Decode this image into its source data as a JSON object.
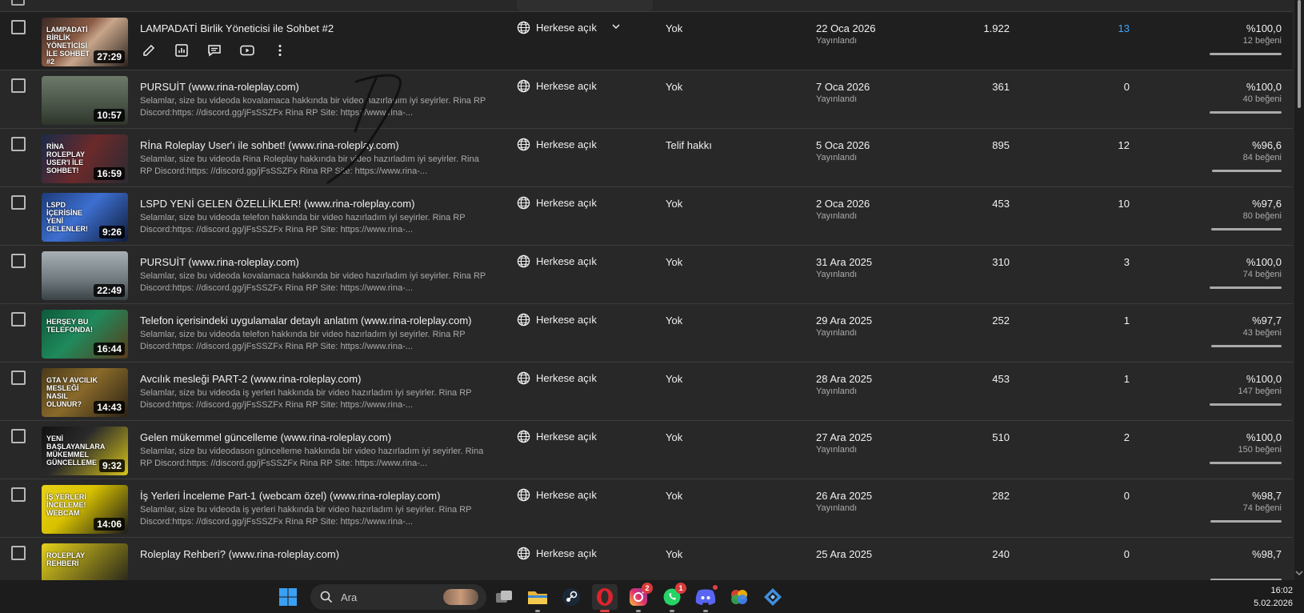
{
  "columns": {
    "visibility_chevron": "chevron-down-icon",
    "date_status": "Yayınlandı",
    "likes_suffix": "beğeni"
  },
  "rows": [
    {
      "title": "LAMPADATİ Birlik Yöneticisi ile Sohbet #2",
      "description": "",
      "duration": "27:29",
      "thumb_caption": "LAMPADATİ BİRLİK YÖNETİCİSİ İLE SOHBET #2",
      "visibility": "Herkese açık",
      "restrictions": "Yok",
      "date": "22 Oca 2026",
      "date_status": "Yayınlandı",
      "views": "1.922",
      "comments": "13",
      "likes_pct": "%100,0",
      "likes_count": "12 beğeni",
      "like_fraction": 1.0,
      "hovered": true
    },
    {
      "title": "PURSUİT (www.rina-roleplay.com)",
      "description": "Selamlar, size bu videoda kovalamaca hakkında bir video hazırladım iyi seyirler. Rina RP Discord:https: //discord.gg/jFsSSZFx Rina RP Site: https://www.rina-...",
      "duration": "10:57",
      "thumb_caption": "",
      "visibility": "Herkese açık",
      "restrictions": "Yok",
      "date": "7 Oca 2026",
      "date_status": "Yayınlandı",
      "views": "361",
      "comments": "0",
      "likes_pct": "%100,0",
      "likes_count": "40 beğeni",
      "like_fraction": 1.0
    },
    {
      "title": "Rİna Roleplay User'ı ile sohbet! (www.rina-roleplay.com)",
      "description": "Selamlar, size bu videoda Rina Roleplay hakkında bir video hazırladım iyi seyirler. Rina RP Discord:https: //discord.gg/jFsSSZFx Rina RP Site: https://www.rina-...",
      "duration": "16:59",
      "thumb_caption": "RİNA ROLEPLAY USER'I İLE SOHBET!",
      "visibility": "Herkese açık",
      "restrictions": "Telif hakkı",
      "date": "5 Oca 2026",
      "date_status": "Yayınlandı",
      "views": "895",
      "comments": "12",
      "likes_pct": "%96,6",
      "likes_count": "84 beğeni",
      "like_fraction": 0.966
    },
    {
      "title": "LSPD YENİ GELEN ÖZELLİKLER! (www.rina-roleplay.com)",
      "description": "Selamlar, size bu videoda telefon hakkında bir video hazırladım iyi seyirler. Rina RP Discord:https: //discord.gg/jFsSSZFx Rina RP Site: https://www.rina-...",
      "duration": "9:26",
      "thumb_caption": "LSPD İÇERİSİNE YENİ GELENLER!",
      "visibility": "Herkese açık",
      "restrictions": "Yok",
      "date": "2 Oca 2026",
      "date_status": "Yayınlandı",
      "views": "453",
      "comments": "10",
      "likes_pct": "%97,6",
      "likes_count": "80 beğeni",
      "like_fraction": 0.976
    },
    {
      "title": "PURSUİT (www.rina-roleplay.com)",
      "description": "Selamlar, size bu videoda kovalamaca hakkında bir video hazırladım iyi seyirler. Rina RP Discord:https: //discord.gg/jFsSSZFx Rina RP Site: https://www.rina-...",
      "duration": "22:49",
      "thumb_caption": "",
      "visibility": "Herkese açık",
      "restrictions": "Yok",
      "date": "31 Ara 2025",
      "date_status": "Yayınlandı",
      "views": "310",
      "comments": "3",
      "likes_pct": "%100,0",
      "likes_count": "74 beğeni",
      "like_fraction": 1.0
    },
    {
      "title": "Telefon içerisindeki uygulamalar detaylı anlatım (www.rina-roleplay.com)",
      "description": "Selamlar, size bu videoda telefon hakkında bir video hazırladım iyi seyirler. Rina RP Discord:https: //discord.gg/jFsSSZFx Rina RP Site: https://www.rina-...",
      "duration": "16:44",
      "thumb_caption": "HERŞEY BU TELEFONDA!",
      "visibility": "Herkese açık",
      "restrictions": "Yok",
      "date": "29 Ara 2025",
      "date_status": "Yayınlandı",
      "views": "252",
      "comments": "1",
      "likes_pct": "%97,7",
      "likes_count": "43 beğeni",
      "like_fraction": 0.977
    },
    {
      "title": "Avcılık mesleği PART-2 (www.rina-roleplay.com)",
      "description": "Selamlar, size bu videoda iş yerleri hakkında bir video hazırladım iyi seyirler. Rina RP Discord:https: //discord.gg/jFsSSZFx Rina RP Site: https://www.rina-...",
      "duration": "14:43",
      "thumb_caption": "GTA V AVCILIK MESLEĞİ NASIL OLUNUR?",
      "visibility": "Herkese açık",
      "restrictions": "Yok",
      "date": "28 Ara 2025",
      "date_status": "Yayınlandı",
      "views": "453",
      "comments": "1",
      "likes_pct": "%100,0",
      "likes_count": "147 beğeni",
      "like_fraction": 1.0
    },
    {
      "title": "Gelen mükemmel güncelleme (www.rina-roleplay.com)",
      "description": "Selamlar, size bu videodason güncelleme hakkında bir video hazırladım iyi seyirler. Rina RP Discord:https: //discord.gg/jFsSSZFx Rina RP Site: https://www.rina-...",
      "duration": "9:32",
      "thumb_caption": "YENİ BAŞLAYANLARA MÜKEMMEL GÜNCELLEME",
      "visibility": "Herkese açık",
      "restrictions": "Yok",
      "date": "27 Ara 2025",
      "date_status": "Yayınlandı",
      "views": "510",
      "comments": "2",
      "likes_pct": "%100,0",
      "likes_count": "150 beğeni",
      "like_fraction": 1.0
    },
    {
      "title": "İş Yerleri İnceleme Part-1 (webcam özel) (www.rina-roleplay.com)",
      "description": "Selamlar, size bu videoda iş yerleri hakkında bir video hazırladım iyi seyirler. Rina RP Discord:https: //discord.gg/jFsSSZFx Rina RP Site: https://www.rina-...",
      "duration": "14:06",
      "thumb_caption": "İŞ YERLERİ İNCELEME! WEBCAM",
      "visibility": "Herkese açık",
      "restrictions": "Yok",
      "date": "26 Ara 2025",
      "date_status": "Yayınlandı",
      "views": "282",
      "comments": "0",
      "likes_pct": "%98,7",
      "likes_count": "74 beğeni",
      "like_fraction": 0.987
    },
    {
      "title": "Roleplay Rehberi? (www.rina-roleplay.com)",
      "description": "",
      "duration": "",
      "thumb_caption": "ROLEPLAY REHBERİ",
      "visibility": "Herkese açık",
      "restrictions": "Yok",
      "date": "25 Ara 2025",
      "date_status": "",
      "views": "240",
      "comments": "0",
      "likes_pct": "%98,7",
      "likes_count": "",
      "like_fraction": 0.987
    }
  ],
  "row_actions": [
    "pencil-icon",
    "analytics-icon",
    "comments-icon",
    "youtube-play-icon",
    "more-vert-icon"
  ],
  "taskbar": {
    "search_placeholder": "Ara",
    "time": "16:02",
    "date": "5.02.2026",
    "apps": [
      "windows-start-icon",
      "search-icon",
      "task-view-icon",
      "file-explorer-icon",
      "steam-icon",
      "opera-icon",
      "instagram-icon",
      "whatsapp-icon",
      "discord-icon",
      "chrome-icon",
      "app-icon"
    ],
    "badges": {
      "instagram": "2",
      "whatsapp": "1"
    }
  },
  "colors": {
    "background": "#282828",
    "hover_row": "#1f1f1f",
    "link_blue": "#3ea6ff",
    "text": "#f1f1f1",
    "muted": "#aaaaaa",
    "taskbar": "#1c1c1c"
  }
}
